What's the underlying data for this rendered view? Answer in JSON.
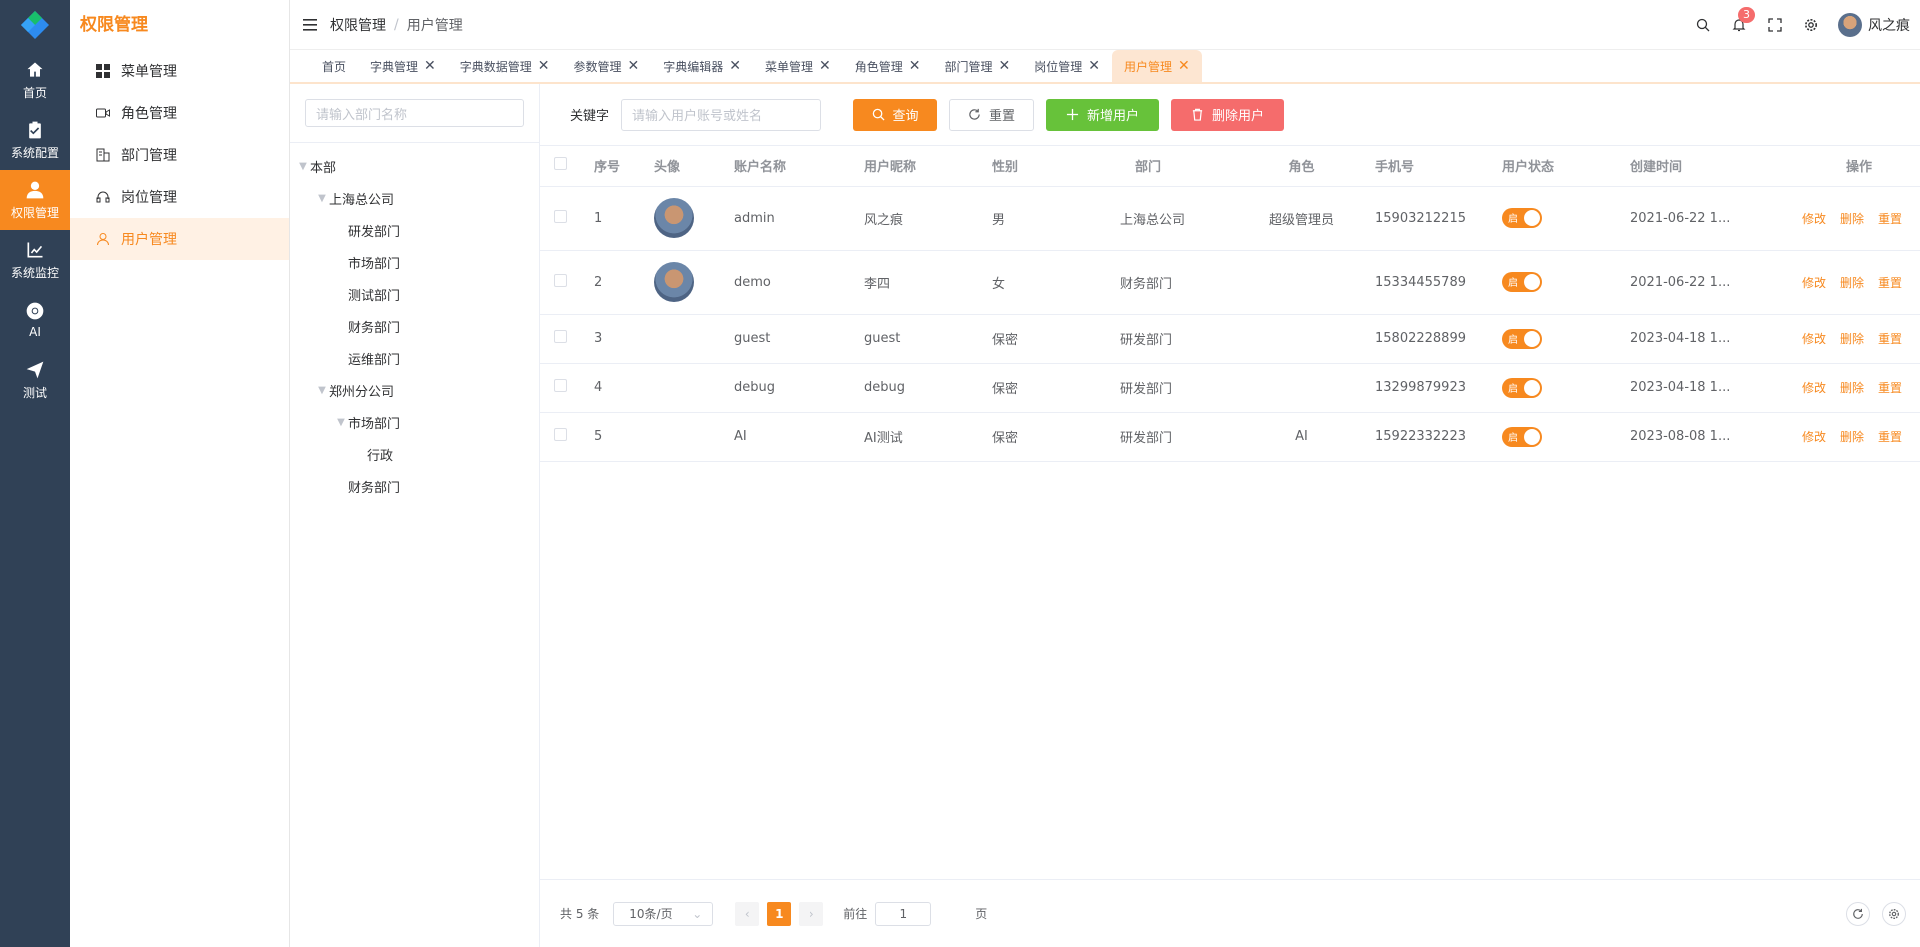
{
  "rail": {
    "items": [
      {
        "label": "首页",
        "icon": "home-icon"
      },
      {
        "label": "系统配置",
        "icon": "clipboard-check-icon"
      },
      {
        "label": "权限管理",
        "icon": "user-icon",
        "active": true
      },
      {
        "label": "系统监控",
        "icon": "chart-line-icon"
      },
      {
        "label": "AI",
        "icon": "chrome-icon"
      },
      {
        "label": "测试",
        "icon": "paper-plane-icon"
      }
    ]
  },
  "submenu": {
    "title": "权限管理",
    "items": [
      {
        "label": "菜单管理",
        "icon": "grid-icon"
      },
      {
        "label": "角色管理",
        "icon": "video-camera-icon"
      },
      {
        "label": "部门管理",
        "icon": "office-building-icon"
      },
      {
        "label": "岗位管理",
        "icon": "headset-icon"
      },
      {
        "label": "用户管理",
        "icon": "user-icon",
        "active": true
      }
    ]
  },
  "header": {
    "breadcrumb": [
      "权限管理",
      "/",
      "用户管理"
    ],
    "notification_count": "3",
    "username": "风之痕"
  },
  "tags": [
    {
      "label": "首页",
      "closable": false
    },
    {
      "label": "字典管理",
      "closable": true
    },
    {
      "label": "字典数据管理",
      "closable": true
    },
    {
      "label": "参数管理",
      "closable": true
    },
    {
      "label": "字典编辑器",
      "closable": true
    },
    {
      "label": "菜单管理",
      "closable": true
    },
    {
      "label": "角色管理",
      "closable": true
    },
    {
      "label": "部门管理",
      "closable": true
    },
    {
      "label": "岗位管理",
      "closable": true
    },
    {
      "label": "用户管理",
      "closable": true,
      "active": true
    }
  ],
  "dept": {
    "search_placeholder": "请输入部门名称",
    "tree": [
      {
        "label": "本部",
        "level": 0,
        "expandable": true
      },
      {
        "label": "上海总公司",
        "level": 1,
        "expandable": true
      },
      {
        "label": "研发部门",
        "level": 2,
        "expandable": false
      },
      {
        "label": "市场部门",
        "level": 2,
        "expandable": false
      },
      {
        "label": "测试部门",
        "level": 2,
        "expandable": false
      },
      {
        "label": "财务部门",
        "level": 2,
        "expandable": false
      },
      {
        "label": "运维部门",
        "level": 2,
        "expandable": false
      },
      {
        "label": "郑州分公司",
        "level": 1,
        "expandable": true
      },
      {
        "label": "市场部门",
        "level": 2,
        "expandable": true
      },
      {
        "label": "行政",
        "level": 3,
        "expandable": false
      },
      {
        "label": "财务部门",
        "level": 2,
        "expandable": false
      }
    ]
  },
  "toolbar": {
    "keyword_label": "关键字",
    "keyword_placeholder": "请输入用户账号或姓名",
    "search_label": "查询",
    "reset_label": "重置",
    "add_label": "新增用户",
    "delete_label": "删除用户"
  },
  "table": {
    "columns": [
      "序号",
      "头像",
      "账户名称",
      "用户昵称",
      "性别",
      "部门",
      "角色",
      "手机号",
      "用户状态",
      "创建时间",
      "操作"
    ],
    "rows": [
      {
        "index": "1",
        "has_avatar": true,
        "account": "admin",
        "nickname": "风之痕",
        "gender": "男",
        "dept": "上海总公司",
        "role": "超级管理员",
        "phone": "15903212215",
        "status": "启",
        "created": "2021-06-22 1..."
      },
      {
        "index": "2",
        "has_avatar": true,
        "account": "demo",
        "nickname": "李四",
        "gender": "女",
        "dept": "财务部门",
        "role": "",
        "phone": "15334455789",
        "status": "启",
        "created": "2021-06-22 1..."
      },
      {
        "index": "3",
        "has_avatar": false,
        "account": "guest",
        "nickname": "guest",
        "gender": "保密",
        "dept": "研发部门",
        "role": "",
        "phone": "15802228899",
        "status": "启",
        "created": "2023-04-18 1..."
      },
      {
        "index": "4",
        "has_avatar": false,
        "account": "debug",
        "nickname": "debug",
        "gender": "保密",
        "dept": "研发部门",
        "role": "",
        "phone": "13299879923",
        "status": "启",
        "created": "2023-04-18 1..."
      },
      {
        "index": "5",
        "has_avatar": false,
        "account": "AI",
        "nickname": "AI测试",
        "gender": "保密",
        "dept": "研发部门",
        "role": "AI",
        "phone": "15922332223",
        "status": "启",
        "created": "2023-08-08 1..."
      }
    ],
    "actions": [
      "修改",
      "删除",
      "重置"
    ]
  },
  "pager": {
    "total": "共 5 条",
    "page_size": "10条/页",
    "current_page": "1",
    "goto_label": "前往",
    "goto_value": "1",
    "page_suffix": "页"
  },
  "colors": {
    "accent": "#f7891f",
    "rail_bg": "#304156",
    "success": "#67c23a",
    "danger": "#f56c6c"
  }
}
